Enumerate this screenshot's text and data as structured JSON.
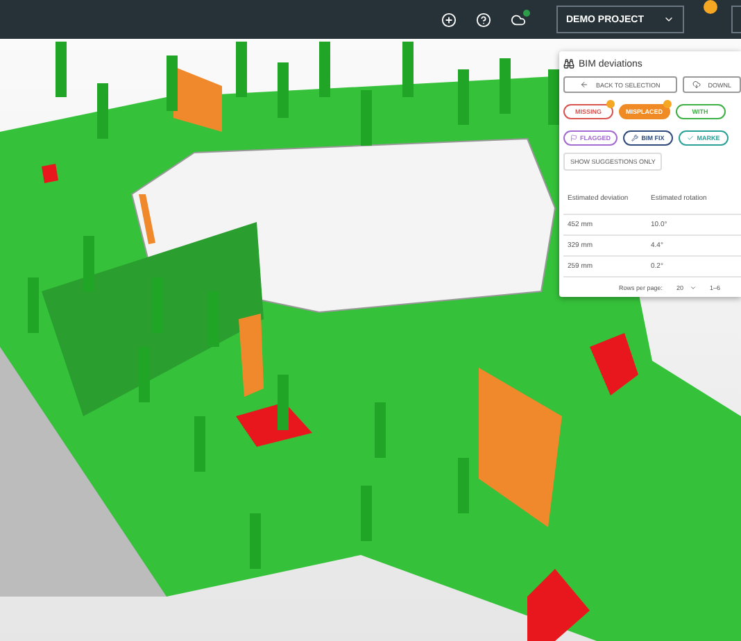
{
  "top_bar": {
    "project_select": {
      "value": "DEMO PROJECT"
    },
    "sync_status": {
      "on": true
    },
    "alert": {
      "on": true
    }
  },
  "panel": {
    "title": "BIM deviations",
    "actions": [
      {
        "label": "BACK TO SELECTION",
        "kind": "back"
      },
      {
        "label": "DOWNL",
        "kind": "download"
      }
    ],
    "filters": [
      {
        "label": "MISSING",
        "selected": false,
        "color": "#d9534f",
        "badge": true
      },
      {
        "label": "MISPLACED",
        "selected": true,
        "color": "#f08a24",
        "badge": true
      },
      {
        "label": "WITH",
        "selected": false,
        "color": "#3cb043",
        "badge": false
      },
      {
        "label": "FLAGGED",
        "selected": false,
        "color": "#a36ad1",
        "badge": false
      },
      {
        "label": "BIM FIX",
        "selected": false,
        "color": "#2f4a7a",
        "badge": false
      },
      {
        "label": "MARKE",
        "selected": false,
        "color": "#2aa198",
        "badge": false
      }
    ],
    "toggle": {
      "label": "SHOW SUGGESTIONS ONLY",
      "checked": false
    },
    "table": {
      "columns": [
        "Estimated deviation",
        "Estimated rotation"
      ],
      "rows": [
        [
          "452 mm",
          "10.0°"
        ],
        [
          "329 mm",
          "4.4°"
        ],
        [
          "259 mm",
          "0.2°"
        ]
      ]
    },
    "pagination": {
      "label": "Rows per page:",
      "value": "20",
      "range": "1–6"
    }
  }
}
